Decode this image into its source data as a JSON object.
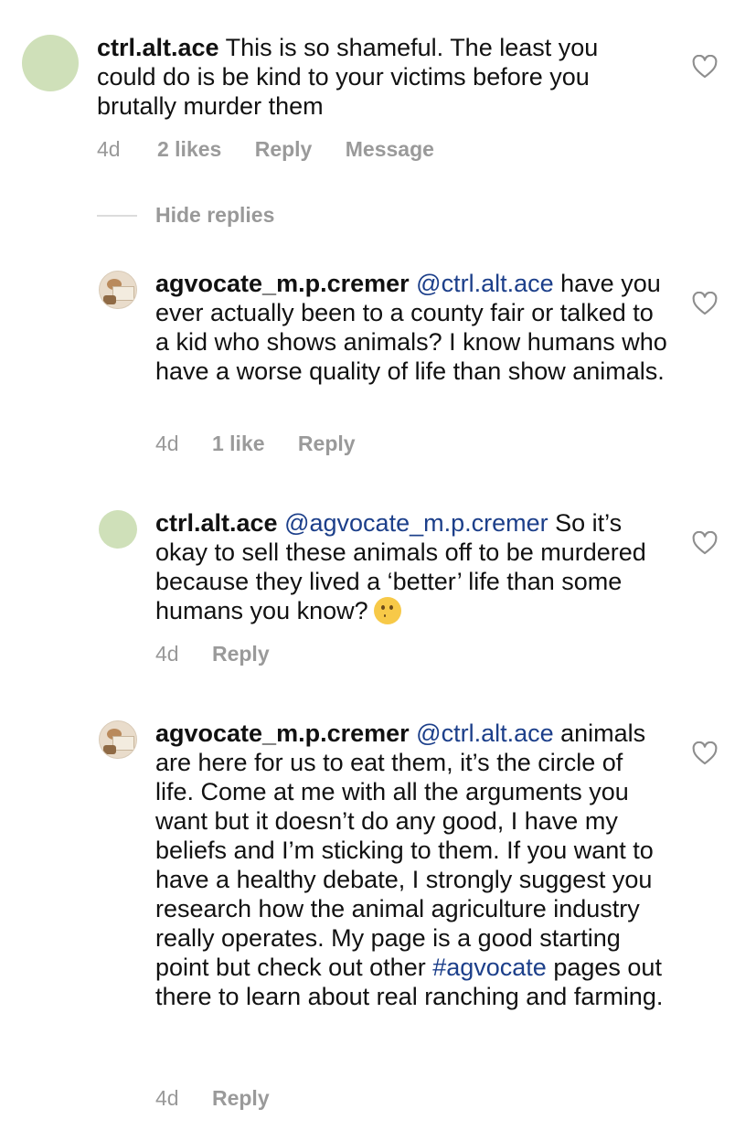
{
  "comments": [
    {
      "username": "ctrl.alt.ace",
      "mention": "",
      "body": "This is so shameful. The least you could do is be kind to your victims before you brutally murder them",
      "time": "4d",
      "likes": "2 likes",
      "reply": "Reply",
      "message": "Message",
      "avatar": "green-circle"
    },
    {
      "username": "agvocate_m.p.cremer",
      "mention": "@ctrl.alt.ace",
      "body": "have you ever actually been to a county fair or talked to a kid who shows animals? I know humans who have a worse quality of life than show animals.",
      "time": "4d",
      "likes": "1 like",
      "reply": "Reply",
      "avatar": "profile-photo"
    },
    {
      "username": "ctrl.alt.ace",
      "mention": "@agvocate_m.p.cremer",
      "body": "So it’s okay to sell these animals off to be murdered because they lived a ‘better’ life than some humans you know?",
      "emoji": "thinking-face-emoji",
      "time": "4d",
      "reply": "Reply",
      "avatar": "green-circle"
    },
    {
      "username": "agvocate_m.p.cremer",
      "mention": "@ctrl.alt.ace",
      "body_before_tag": "animals are here for us to eat them, it’s the circle of life. Come at me with all the arguments you want but it doesn’t do any good, I have my beliefs and I’m sticking to them. If you want to have a healthy debate, I strongly suggest you research how the animal agriculture industry really operates. My page is a good starting point but check out other",
      "hashtag": "#agvocate",
      "body_after_tag": "pages out there to learn about real ranching and farming.",
      "time": "4d",
      "reply": "Reply",
      "avatar": "profile-photo"
    }
  ],
  "hide_replies": "Hide replies",
  "colors": {
    "mention": "#1c3f8a",
    "meta": "#999999",
    "avatar_green": "#cfe0b9"
  },
  "icons": [
    "heart-icon"
  ]
}
